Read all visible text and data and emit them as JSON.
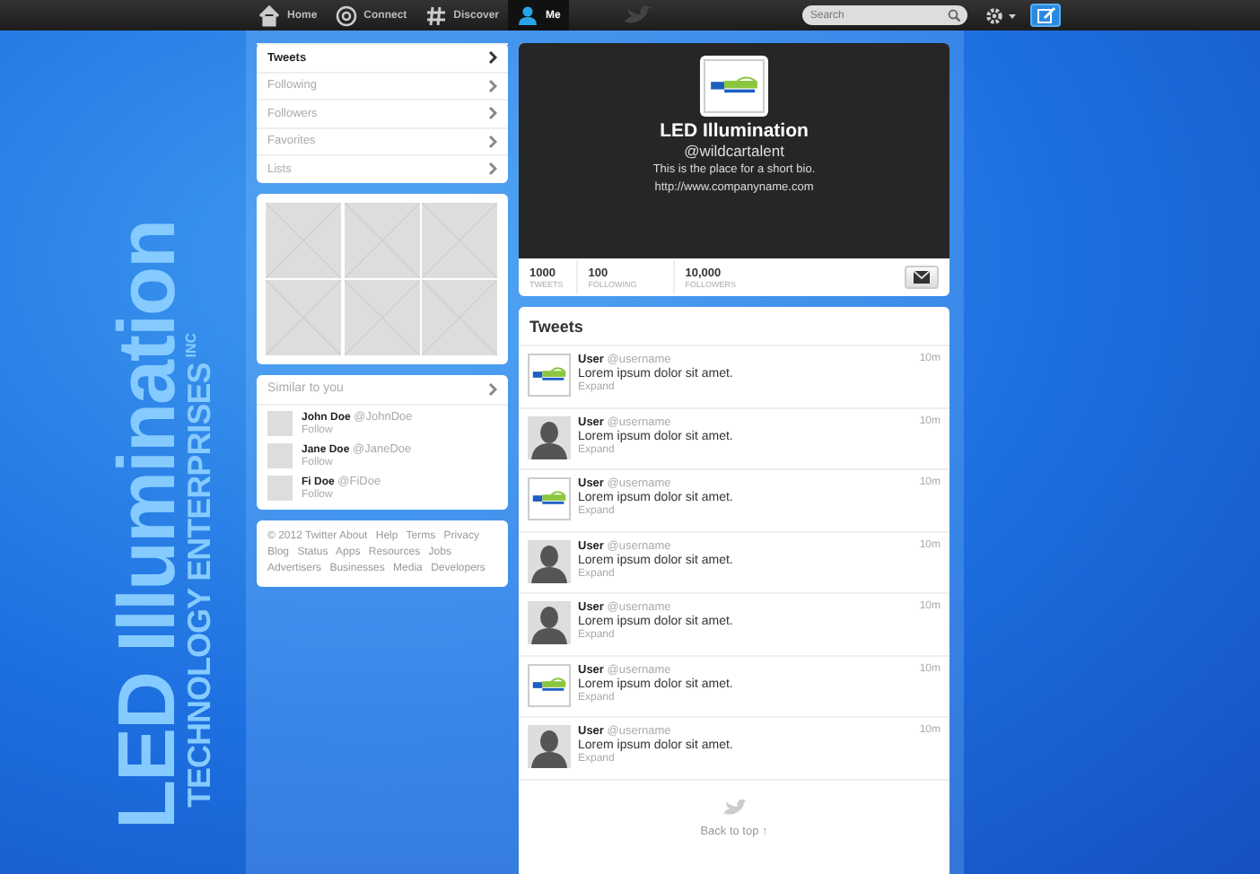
{
  "topbar": {
    "nav": [
      {
        "label": "Home",
        "selected": false
      },
      {
        "label": "Connect",
        "selected": false
      },
      {
        "label": "Discover",
        "selected": false
      },
      {
        "label": "Me",
        "selected": true
      }
    ],
    "search": {
      "placeholder": "Search"
    }
  },
  "background_brand": {
    "title": "LED Illumination",
    "subtitle": "TECHNOLOGY ENTERPRISES",
    "suffix": "INC"
  },
  "sidebar": {
    "nav": [
      {
        "label": "Tweets",
        "selected": true
      },
      {
        "label": "Following",
        "selected": false
      },
      {
        "label": "Followers",
        "selected": false
      },
      {
        "label": "Favorites",
        "selected": false
      },
      {
        "label": "Lists",
        "selected": false
      }
    ],
    "similar": {
      "title": "Similar to you",
      "users": [
        {
          "name": "John Doe",
          "handle": "@JohnDoe",
          "action": "Follow"
        },
        {
          "name": "Jane Doe",
          "handle": "@JaneDoe",
          "action": "Follow"
        },
        {
          "name": "Fi Doe",
          "handle": "@FiDoe",
          "action": "Follow"
        }
      ]
    },
    "footer": [
      "© 2012 Twitter",
      "About",
      "Help",
      "Terms",
      "Privacy",
      "Blog",
      "Status",
      "Apps",
      "Resources",
      "Jobs",
      "Advertisers",
      "Businesses",
      "Media",
      "Developers"
    ]
  },
  "profile": {
    "name": "LED Illumination",
    "handle": "@wildcartalent",
    "bio": "This is the place for a short bio.",
    "url": "http://www.companyname.com",
    "stats": [
      {
        "value": "1000",
        "label": "TWEETS"
      },
      {
        "value": "100",
        "label": "FOLLOWING"
      },
      {
        "value": "10,000",
        "label": "FOLLOWERS"
      }
    ]
  },
  "tweets": {
    "title": "Tweets",
    "items": [
      {
        "kind": "logo",
        "name": "User",
        "handle": "@username",
        "text": "Lorem ipsum dolor sit amet.",
        "action": "Expand",
        "time": "10m"
      },
      {
        "kind": "person",
        "name": "User",
        "handle": "@username",
        "text": "Lorem ipsum dolor sit amet.",
        "action": "Expand",
        "time": "10m"
      },
      {
        "kind": "logo",
        "name": "User",
        "handle": "@username",
        "text": "Lorem ipsum dolor sit amet.",
        "action": "Expand",
        "time": "10m"
      },
      {
        "kind": "person",
        "name": "User",
        "handle": "@username",
        "text": "Lorem ipsum dolor sit amet.",
        "action": "Expand",
        "time": "10m"
      },
      {
        "kind": "person",
        "name": "User",
        "handle": "@username",
        "text": "Lorem ipsum dolor sit amet.",
        "action": "Expand",
        "time": "10m"
      },
      {
        "kind": "logo",
        "name": "User",
        "handle": "@username",
        "text": "Lorem ipsum dolor sit amet.",
        "action": "Expand",
        "time": "10m"
      },
      {
        "kind": "person",
        "name": "User",
        "handle": "@username",
        "text": "Lorem ipsum dolor sit amet.",
        "action": "Expand",
        "time": "10m"
      }
    ],
    "back_to_top": "Back to top ↑"
  }
}
